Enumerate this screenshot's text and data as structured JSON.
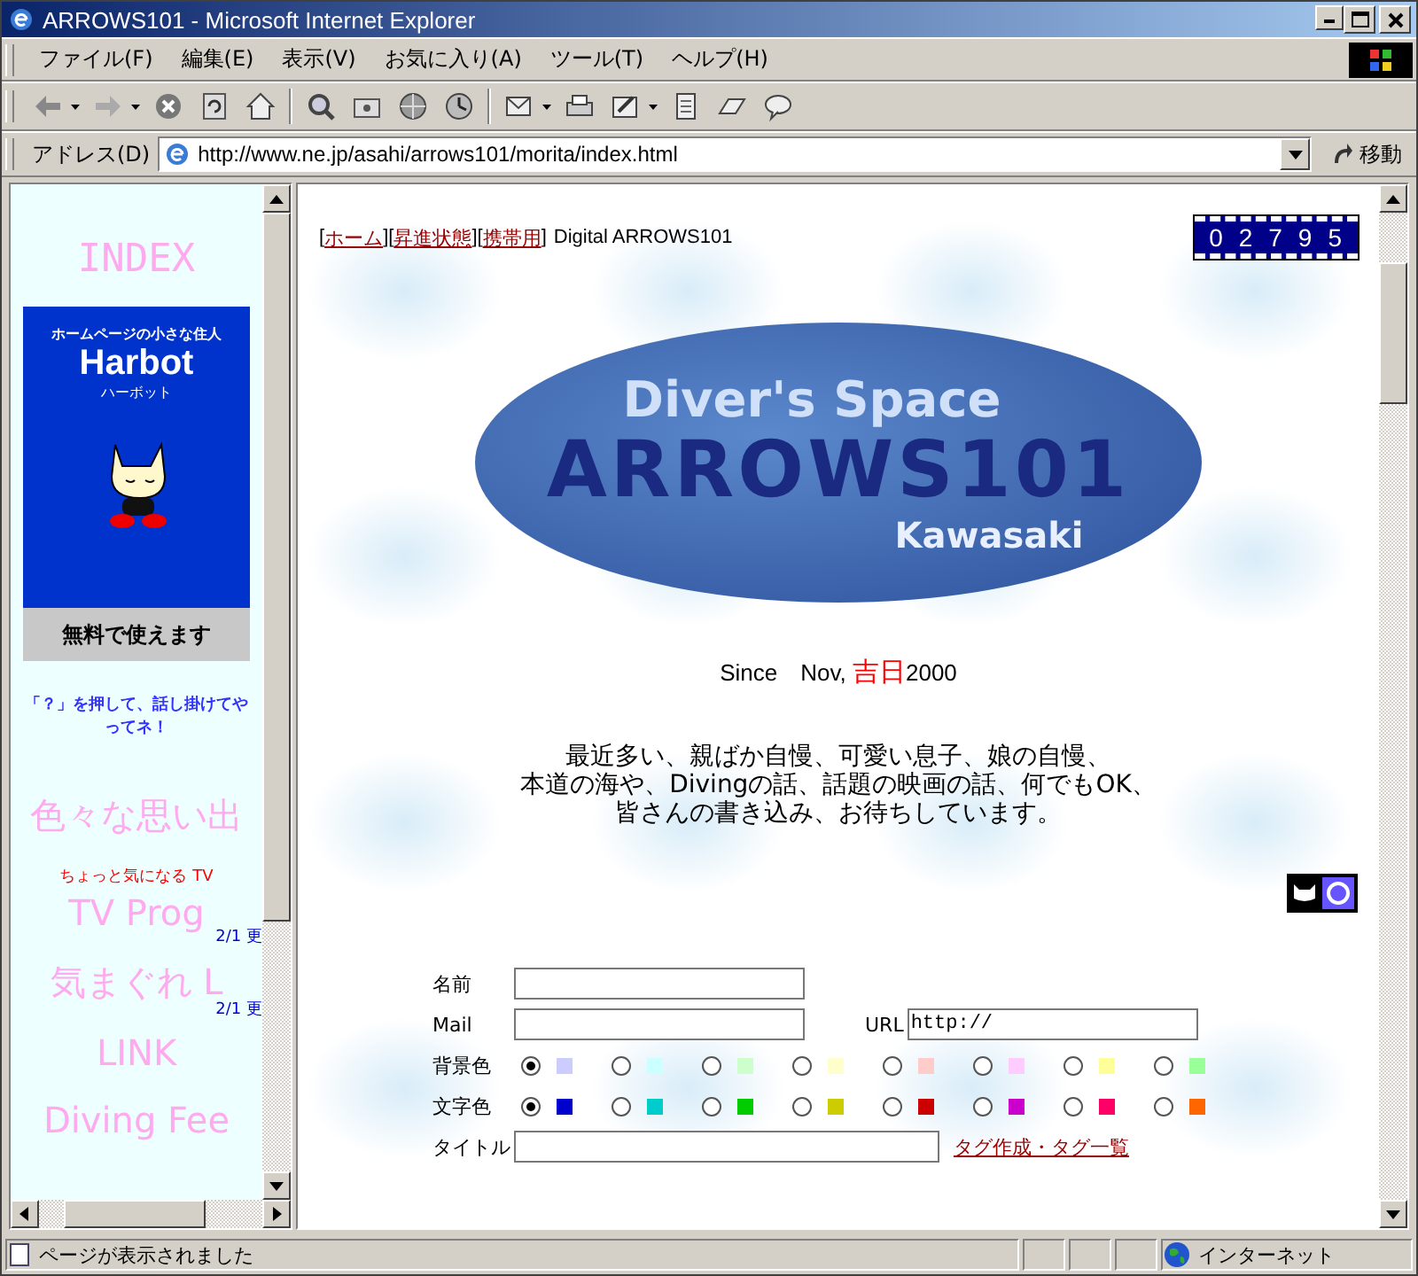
{
  "window": {
    "title": "ARROWS101 - Microsoft Internet Explorer"
  },
  "menu": [
    {
      "label": "ファイル(F)"
    },
    {
      "label": "編集(E)"
    },
    {
      "label": "表示(V)"
    },
    {
      "label": "お気に入り(A)"
    },
    {
      "label": "ツール(T)"
    },
    {
      "label": "ヘルプ(H)"
    }
  ],
  "address": {
    "label": "アドレス(D)",
    "url": "http://www.ne.jp/asahi/arrows101/morita/index.html",
    "go": "移動"
  },
  "sidebar": {
    "heading": "INDEX",
    "banner": {
      "tagline": "ホームページの小さな住人",
      "logo": "Harbot",
      "reading": "ハーボット",
      "caption": "無料で使えます"
    },
    "prompt": "「？」を押して、話し掛けてやってネ！",
    "items": [
      {
        "kind": "title",
        "text": "色々な思い出"
      },
      {
        "kind": "note",
        "text": "ちょっと気になる TV"
      },
      {
        "kind": "title",
        "text": "TV Prog",
        "update": "2/1 更"
      },
      {
        "kind": "title",
        "text": "気まぐれ L",
        "update": "2/1 更"
      },
      {
        "kind": "title",
        "text": "LINK"
      },
      {
        "kind": "title",
        "text": "Diving Fee"
      }
    ]
  },
  "main": {
    "nav": [
      {
        "before": "[",
        "label": "ホーム",
        "after": "]"
      },
      {
        "before": "[",
        "label": "昇進状態",
        "after": "]"
      },
      {
        "before": "[",
        "label": "携帯用",
        "after": "]"
      }
    ],
    "site_name": "Digital ARROWS101",
    "counter": "02795",
    "logo": {
      "line1": "Diver's Space",
      "line2": "ARROWS101",
      "line3": "Kawasaki"
    },
    "since": {
      "before": "Since　Nov, ",
      "highlight": "吉日",
      "after": "2000"
    },
    "intro": [
      "最近多い、親ばか自慢、可愛い息子、娘の自慢、",
      "本道の海や、Divingの話、話題の映画の話、何でもOK、",
      "皆さんの書き込み、お待ちしています。"
    ],
    "form": {
      "name_label": "名前",
      "mail_label": "Mail",
      "url_label": "URL",
      "url_value": "http://",
      "bg_label": "背景色",
      "bg_colors": [
        {
          "color": "#ccccff",
          "selected": true
        },
        {
          "color": "#ccffff",
          "selected": false
        },
        {
          "color": "#ccffcc",
          "selected": false
        },
        {
          "color": "#ffffcc",
          "selected": false
        },
        {
          "color": "#ffcccc",
          "selected": false
        },
        {
          "color": "#ffccff",
          "selected": false
        },
        {
          "color": "#ffff99",
          "selected": false
        },
        {
          "color": "#99ff99",
          "selected": false
        }
      ],
      "text_label": "文字色",
      "text_colors": [
        {
          "color": "#0000cc",
          "selected": true
        },
        {
          "color": "#00cccc",
          "selected": false
        },
        {
          "color": "#00cc00",
          "selected": false
        },
        {
          "color": "#cccc00",
          "selected": false
        },
        {
          "color": "#cc0000",
          "selected": false
        },
        {
          "color": "#cc00cc",
          "selected": false
        },
        {
          "color": "#ff0066",
          "selected": false
        },
        {
          "color": "#ff6600",
          "selected": false
        }
      ],
      "title_label": "タイトル",
      "tag_link": "タグ作成・タグ一覧"
    }
  },
  "status_bar": {
    "message": "ページが表示されました",
    "zone": "インターネット"
  }
}
